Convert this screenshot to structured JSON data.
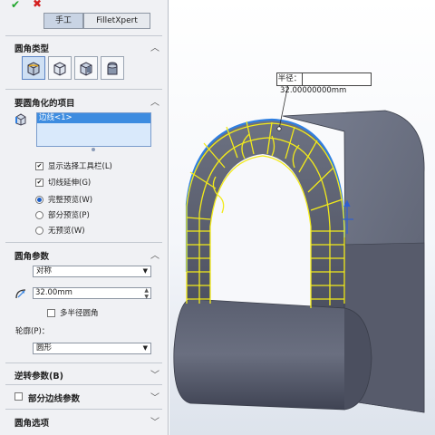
{
  "toolbar": {
    "ok_icon": "checkmark-icon",
    "cancel_icon": "x-icon"
  },
  "tabs": {
    "manual": "手工",
    "filletxpert": "FilletXpert"
  },
  "sections": {
    "fillet_type": "圆角类型",
    "items_to_fillet": "要圆角化的项目",
    "fillet_params": "圆角参数",
    "reverse_params": "逆转参数(B)",
    "partial_edge_params": "部分边线参数",
    "fillet_options": "圆角选项"
  },
  "items": {
    "list": [
      "边线<1>"
    ],
    "show_toolbar": "显示选择工具栏(L)",
    "tangent_propagation": "切线延伸(G)",
    "full_preview": "完整预览(W)",
    "partial_preview": "部分预览(P)",
    "no_preview": "无预览(W)"
  },
  "params": {
    "method": "对称",
    "radius": "32.00mm",
    "multi_radius": "多半径圆角",
    "profile_label": "轮廓(P)：",
    "profile": "圆形"
  },
  "callout": {
    "label": "半径：",
    "value": "32.00000000mm"
  },
  "colors": {
    "model": "#5b6072",
    "preview": "#f2ea1a",
    "selected_edge": "#2f7fe0"
  }
}
